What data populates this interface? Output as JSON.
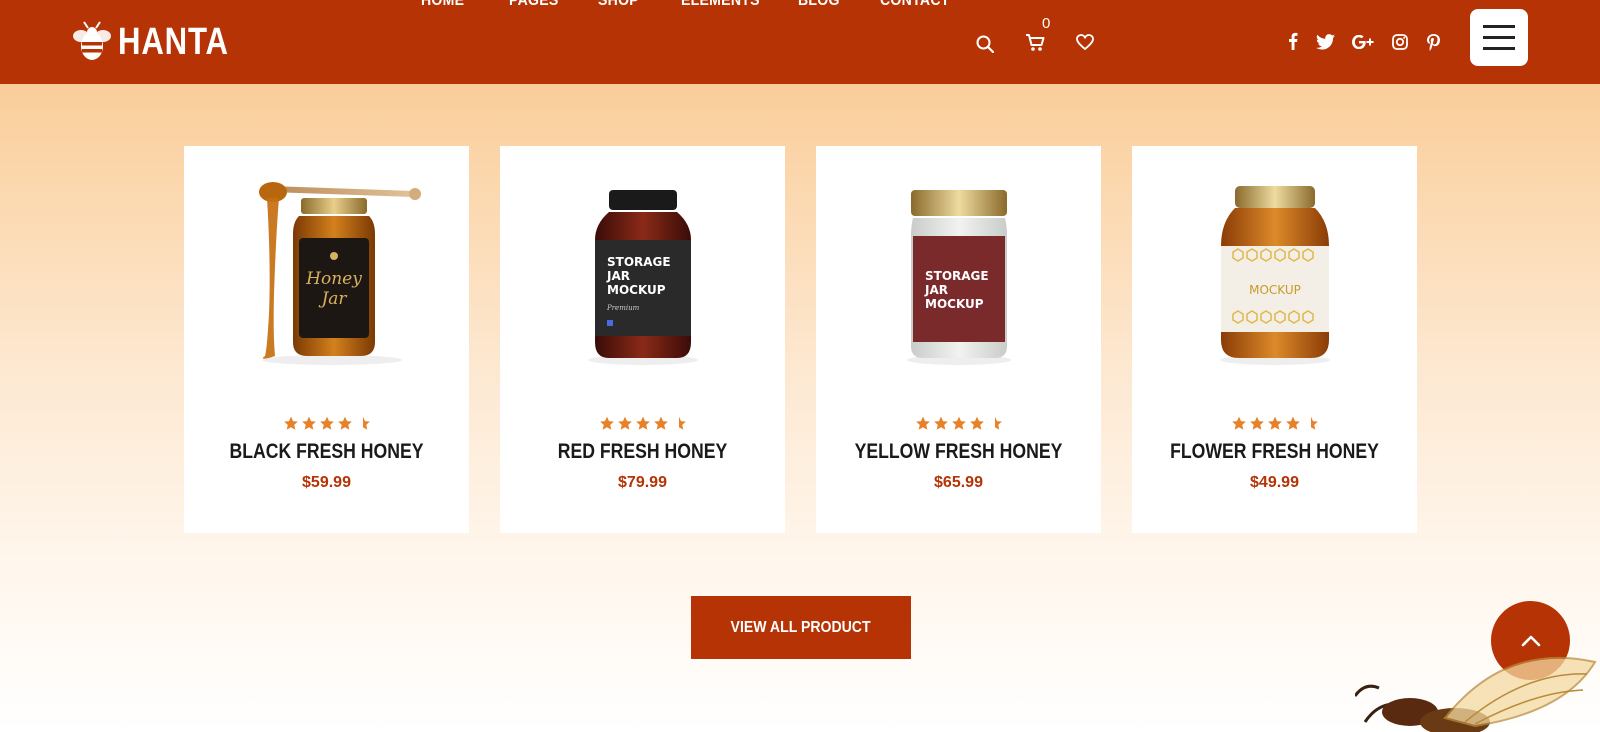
{
  "brand": {
    "name": "HANTA",
    "icon": "bee-logo-icon"
  },
  "nav": {
    "items": [
      {
        "label": "HOME"
      },
      {
        "label": "PAGES"
      },
      {
        "label": "SHOP"
      },
      {
        "label": "ELEMENTS"
      },
      {
        "label": "BLOG"
      },
      {
        "label": "CONTACT"
      }
    ],
    "cart_count": "0",
    "icons": [
      "search-icon",
      "cart-icon",
      "heart-icon"
    ]
  },
  "social": [
    "facebook-icon",
    "twitter-icon",
    "google-plus-icon",
    "instagram-icon",
    "pinterest-icon"
  ],
  "colors": {
    "brand": "#b53305",
    "star": "#e8822a",
    "title": "#1a1a1a"
  },
  "products": [
    {
      "name": "BLACK FRESH HONEY",
      "price": "$59.99",
      "rating": 4.5,
      "jar_label": "Honey Jar"
    },
    {
      "name": "RED FRESH HONEY",
      "price": "$79.99",
      "rating": 4.5,
      "jar_label": "STORAGE JAR MOCKUP"
    },
    {
      "name": "YELLOW FRESH HONEY",
      "price": "$65.99",
      "rating": 4.5,
      "jar_label": "STORAGE JAR MOCKUP"
    },
    {
      "name": "FLOWER FRESH HONEY",
      "price": "$49.99",
      "rating": 4.5,
      "jar_label": "MOCKUP"
    }
  ],
  "cta": {
    "label": "VIEW ALL PRODUCT"
  },
  "back_to_top": {
    "icon": "chevron-up-icon"
  }
}
